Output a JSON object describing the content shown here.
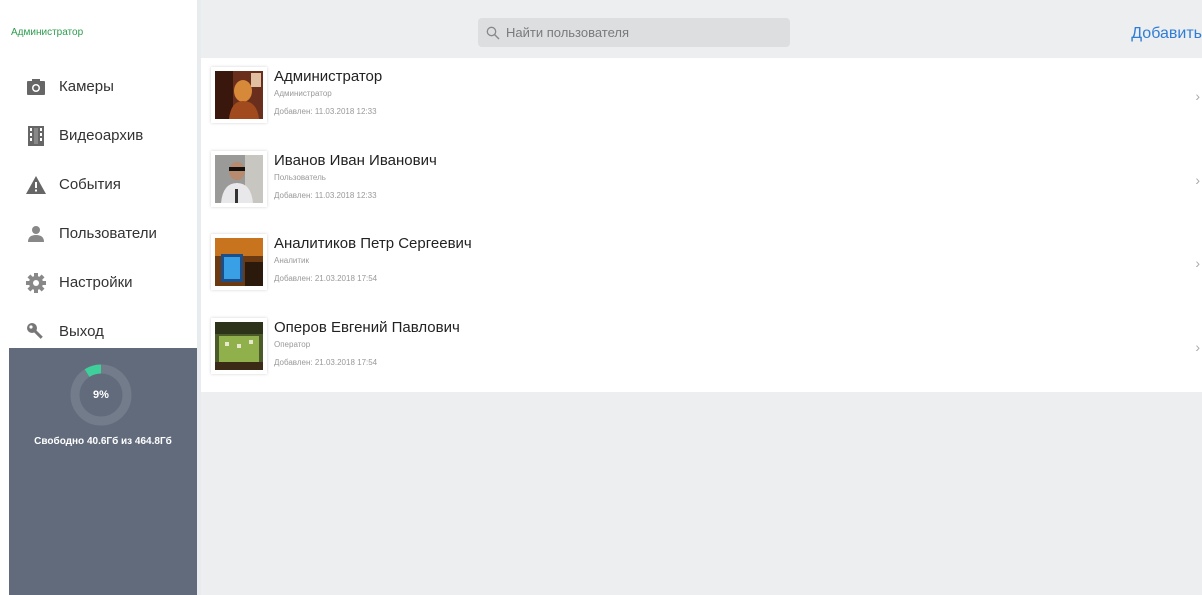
{
  "sidebar": {
    "user_role": "Администратор",
    "nav": [
      {
        "label": "Камеры",
        "icon": "camera-icon"
      },
      {
        "label": "Видеоархив",
        "icon": "film-icon"
      },
      {
        "label": "События",
        "icon": "warning-icon"
      },
      {
        "label": "Пользователи",
        "icon": "user-icon"
      },
      {
        "label": "Настройки",
        "icon": "gear-icon"
      },
      {
        "label": "Выход",
        "icon": "key-icon"
      }
    ],
    "storage": {
      "percent_label": "9%",
      "percent_value": 9,
      "free_text": "Свободно 40.6Гб из 464.8Гб",
      "accent_color": "#3fcf9a"
    }
  },
  "topbar": {
    "search_placeholder": "Найти пользователя",
    "add_label": "Добавить"
  },
  "users": [
    {
      "name": "Администратор",
      "role": "Администратор",
      "added": "Добавлен: 11.03.2018 12:33"
    },
    {
      "name": "Иванов Иван Иванович",
      "role": "Пользователь",
      "added": "Добавлен: 11.03.2018 12:33"
    },
    {
      "name": "Аналитиков Петр Сергеевич",
      "role": "Аналитик",
      "added": "Добавлен: 21.03.2018 17:54"
    },
    {
      "name": "Оперов Евгений Павлович",
      "role": "Оператор",
      "added": "Добавлен: 21.03.2018 17:54"
    }
  ],
  "colors": {
    "accent_green": "#2e9c4e",
    "link_blue": "#2f7dd6",
    "storage_panel": "#616b7c"
  }
}
